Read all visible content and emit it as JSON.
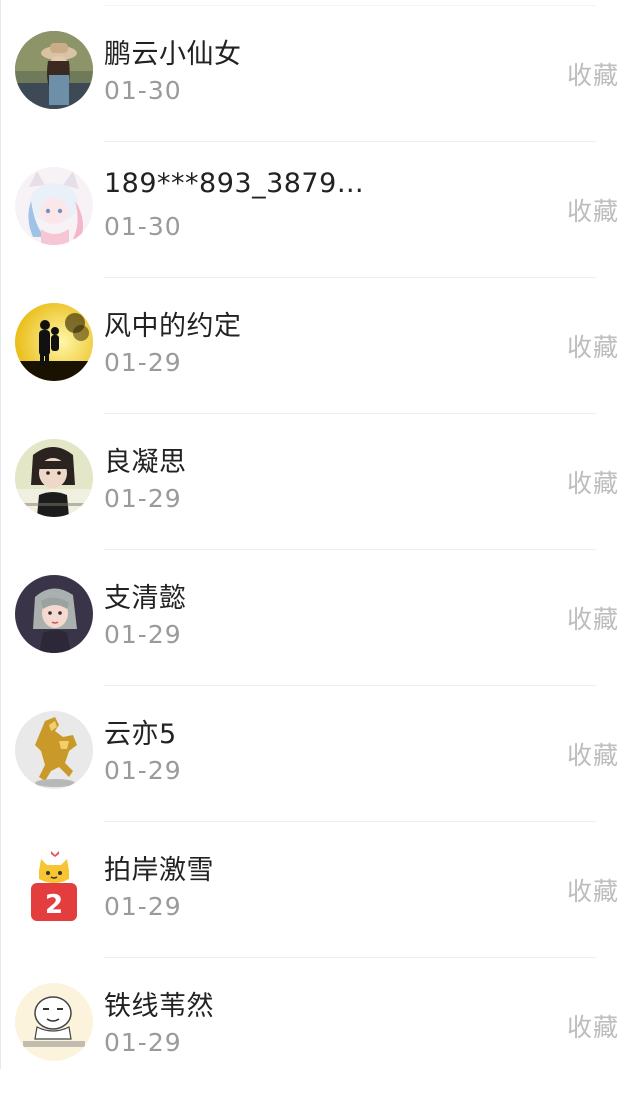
{
  "favorite_label": "收藏",
  "items": [
    {
      "name": "鹏云小仙女",
      "date": "01-30",
      "avatar": "woman-with-hat-photo"
    },
    {
      "name": "189***893_3879…",
      "date": "01-30",
      "avatar": "anime-girl-drawing"
    },
    {
      "name": "风中的约定",
      "date": "01-29",
      "avatar": "couple-silhouette-sunset"
    },
    {
      "name": "良凝思",
      "date": "01-29",
      "avatar": "girl-selfie-photo"
    },
    {
      "name": "支清懿",
      "date": "01-29",
      "avatar": "illustrated-girl-portrait"
    },
    {
      "name": "云亦5",
      "date": "01-29",
      "avatar": "golden-horse-statue"
    },
    {
      "name": "拍岸激雪",
      "date": "01-29",
      "avatar": "cartoon-cat-number-badge"
    },
    {
      "name": "铁线苇然",
      "date": "01-29",
      "avatar": "meme-face-sticker"
    }
  ]
}
